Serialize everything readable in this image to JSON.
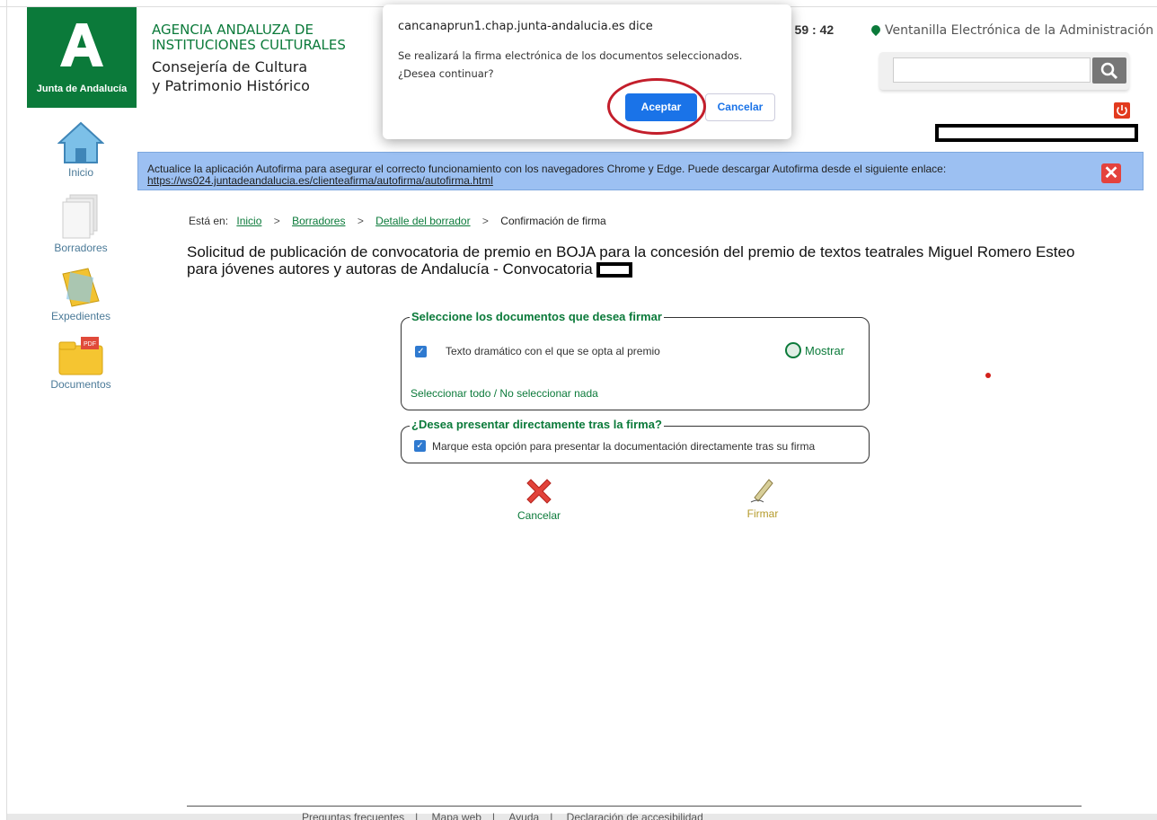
{
  "header": {
    "logo_text": "Junta de Andalucía",
    "agency_line1": "AGENCIA ANDALUZA DE",
    "agency_line2": "INSTITUCIONES CULTURALES",
    "consejeria_line1": "Consejería de Cultura",
    "consejeria_line2": "y Patrimonio Histórico",
    "clock": ": 59 : 42",
    "ventanilla": "Ventanilla Electrónica de la Administración",
    "search_placeholder": ""
  },
  "sidebar": {
    "items": [
      {
        "label": "Inicio",
        "icon": "home-icon"
      },
      {
        "label": "Borradores",
        "icon": "drafts-icon"
      },
      {
        "label": "Expedientes",
        "icon": "folder-icon"
      },
      {
        "label": "Documentos",
        "icon": "pdf-folder-icon"
      }
    ]
  },
  "banner": {
    "text": "Actualice la aplicación Autofirma para asegurar el correcto funcionamiento con los navegadores Chrome y Edge. Puede descargar Autofirma desde el siguiente enlace:",
    "link": "https://ws024.juntadeandalucia.es/clienteafirma/autofirma/autofirma.html"
  },
  "breadcrumb": {
    "prefix": "Está en:",
    "items": [
      "Inicio",
      "Borradores",
      "Detalle del borrador"
    ],
    "current": "Confirmación de firma",
    "separator": ">"
  },
  "page": {
    "title_line1": "Solicitud de publicación de convocatoria de premio en BOJA para la concesión del premio de textos teatrales Miguel Romero Esteo",
    "title_line2": "para jóvenes autores y autoras de Andalucía - Convocatoria"
  },
  "documents": {
    "legend": "Seleccione los documentos que desea firmar",
    "items": [
      {
        "label": "Texto dramático con el que se opta al premio",
        "checked": true,
        "action": "Mostrar"
      }
    ],
    "select_all": "Seleccionar todo",
    "select_none": "No seleccionar nada",
    "select_separator": "/"
  },
  "submit_option": {
    "legend": "¿Desea presentar directamente tras la firma?",
    "label": "Marque esta opción para presentar la documentación directamente tras su firma",
    "checked": true
  },
  "actions": {
    "cancel": "Cancelar",
    "sign": "Firmar"
  },
  "footer": {
    "items": [
      "Preguntas frecuentes",
      "Mapa web",
      "Ayuda",
      "Declaración de accesibilidad"
    ],
    "separator": "|"
  },
  "dialog": {
    "title": "cancanaprun1.chap.junta-andalucia.es dice",
    "message_line1": "Se realizará la firma electrónica de los documentos seleccionados.",
    "message_line2": "¿Desea continuar?",
    "ok": "Aceptar",
    "cancel": "Cancelar"
  },
  "colors": {
    "brand_green": "#0b7a3a",
    "banner_blue": "#9cc0f2",
    "dialog_primary": "#1a73e8",
    "highlight_red": "#c31e2b"
  }
}
